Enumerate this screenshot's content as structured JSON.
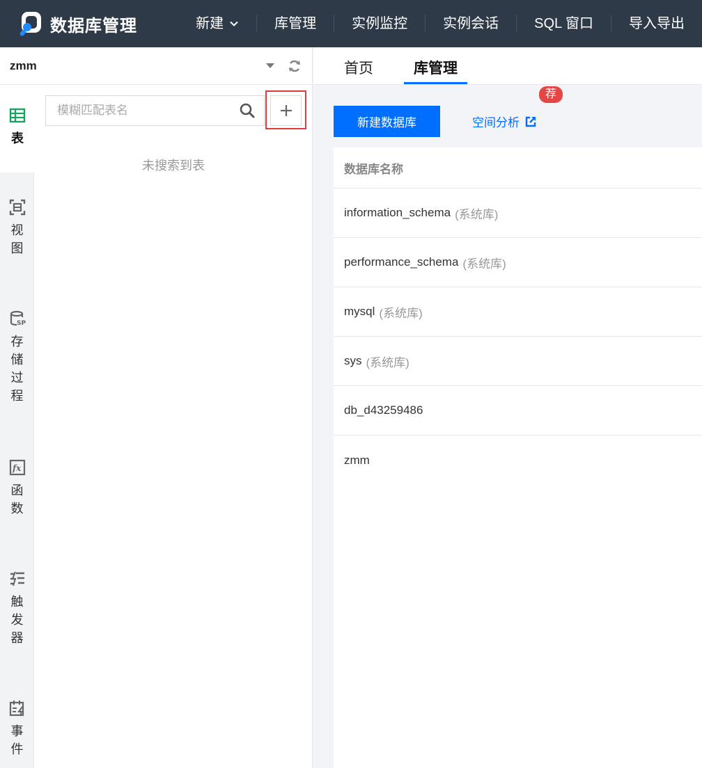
{
  "app": {
    "title": "数据库管理",
    "brand_color": "#2f3a48",
    "accent": "#006eff"
  },
  "nav": {
    "items": [
      {
        "label": "新建",
        "has_dropdown": true
      },
      {
        "label": "库管理"
      },
      {
        "label": "实例监控"
      },
      {
        "label": "实例会话"
      },
      {
        "label": "SQL 窗口"
      },
      {
        "label": "导入导出"
      }
    ]
  },
  "sidebar": {
    "db_selector": {
      "value": "zmm"
    },
    "tabs": [
      {
        "label": "表",
        "icon": "table-icon",
        "active": true
      },
      {
        "label": "视图",
        "icon": "view-icon"
      },
      {
        "label": "存储过程",
        "icon": "procedure-icon"
      },
      {
        "label": "函数",
        "icon": "function-icon"
      },
      {
        "label": "触发器",
        "icon": "trigger-icon"
      },
      {
        "label": "事件",
        "icon": "event-icon"
      }
    ],
    "search": {
      "placeholder": "模糊匹配表名",
      "value": ""
    },
    "empty_text": "未搜索到表"
  },
  "main": {
    "tabs": [
      {
        "label": "首页",
        "active": false
      },
      {
        "label": "库管理",
        "active": true
      }
    ],
    "create_button": "新建数据库",
    "space_analysis": {
      "label": "空间分析",
      "badge": "荐"
    },
    "table": {
      "header": "数据库名称",
      "rows": [
        {
          "name": "information_schema",
          "tag": "(系统库)"
        },
        {
          "name": "performance_schema",
          "tag": "(系统库)"
        },
        {
          "name": "mysql",
          "tag": "(系统库)"
        },
        {
          "name": "sys",
          "tag": "(系统库)"
        },
        {
          "name": "db_d43259486",
          "tag": ""
        },
        {
          "name": "zmm",
          "tag": ""
        }
      ]
    }
  }
}
